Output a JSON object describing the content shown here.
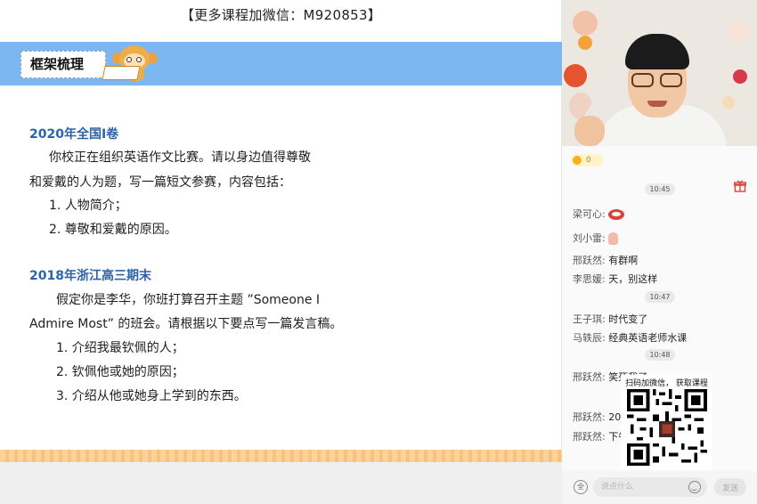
{
  "banner": {
    "text": "【更多课程加微信：M920853】"
  },
  "slide": {
    "section_title": "框架梳理",
    "q1": {
      "title": "2020年全国I卷",
      "lines": [
        "你校正在组织英语作文比赛。请以身边值得尊敬",
        "和爱戴的人为题，写一篇短文参赛，内容包括：",
        "1. 人物简介；",
        "2. 尊敬和爱戴的原因。"
      ]
    },
    "q2": {
      "title": "2018年浙江高三期末",
      "lines": [
        "假定你是李华，你班打算召开主题 ”Someone I",
        "Admire Most” 的班会。请根据以下要点写一篇发言稿。",
        "1. 介绍我最钦佩的人；",
        "2. 钦佩他或她的原因；",
        "3. 介绍从他或她身上学到的东西。"
      ]
    }
  },
  "chat": {
    "likes_count": "0",
    "timestamps": [
      "10:45",
      "10:47",
      "10:48"
    ],
    "messages": [
      {
        "user": "梁可心:",
        "text": "",
        "emoji": "red-lips-emoji"
      },
      {
        "user": "刘小雷:",
        "text": "",
        "emoji": "hand-emoji"
      },
      {
        "user": "邢跃然:",
        "text": "有群啊"
      },
      {
        "user": "李思媛:",
        "text": "天，别这样"
      },
      {
        "user": "王子琪:",
        "text": "时代变了"
      },
      {
        "user": "马轶辰:",
        "text": "经典英语老师水课"
      },
      {
        "user": "邢跃然:",
        "text": "笑死我了"
      },
      {
        "user": "邢跃然:",
        "text": "202"
      },
      {
        "user": "邢跃然:",
        "text": "下午"
      }
    ],
    "qr_caption": "扫码加微信， 获取课程",
    "input_placeholder": "说点什么",
    "send_label": "发送",
    "left_button_label": "全"
  },
  "colors": {
    "header_band": "#7db7f2",
    "title_blue": "#2d63a8",
    "accent_orange": "#f9c37f"
  }
}
